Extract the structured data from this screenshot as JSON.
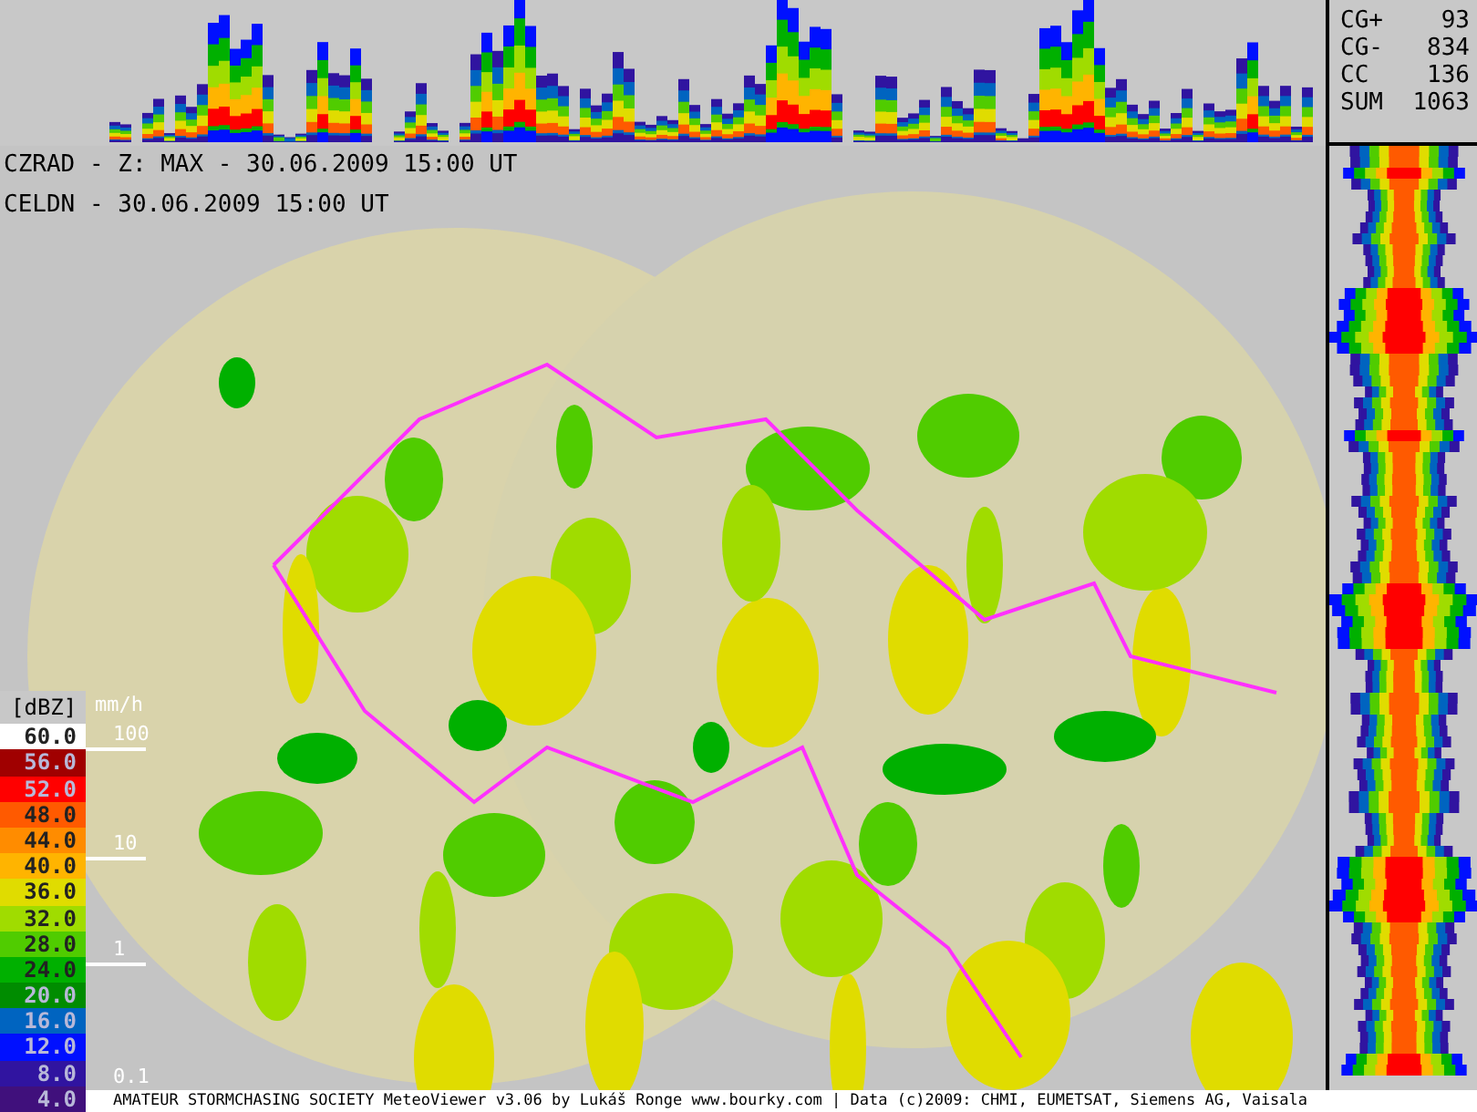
{
  "stats": [
    {
      "label": "CG+",
      "value": "93"
    },
    {
      "label": "CG-",
      "value": "834"
    },
    {
      "label": "CC",
      "value": "136"
    },
    {
      "label": "SUM",
      "value": "1063"
    }
  ],
  "header_lines": [
    "CZRAD - Z: MAX - 30.06.2009 15:00 UT",
    "CELDN - 30.06.2009 15:00 UT"
  ],
  "legend": {
    "unit": "[dBZ]",
    "items": [
      {
        "label": "60.0",
        "color": "#ffffff"
      },
      {
        "label": "56.0",
        "color": "#a00000"
      },
      {
        "label": "52.0",
        "color": "#ff0000"
      },
      {
        "label": "48.0",
        "color": "#ff5a00"
      },
      {
        "label": "44.0",
        "color": "#ff8c00"
      },
      {
        "label": "40.0",
        "color": "#ffb400"
      },
      {
        "label": "36.0",
        "color": "#e0dc00"
      },
      {
        "label": "32.0",
        "color": "#a0dc00"
      },
      {
        "label": "28.0",
        "color": "#50cc00"
      },
      {
        "label": "24.0",
        "color": "#00b000"
      },
      {
        "label": "20.0",
        "color": "#008c00"
      },
      {
        "label": "16.0",
        "color": "#0064c0"
      },
      {
        "label": "12.0",
        "color": "#0010ff"
      },
      {
        "label": "8.0",
        "color": "#3014a0"
      },
      {
        "label": "4.0",
        "color": "#40107c"
      }
    ]
  },
  "rain_scale": {
    "unit": "mm/h",
    "marks": [
      "100",
      "10",
      "1",
      "0.1"
    ]
  },
  "footer": "AMATEUR STORMCHASING SOCIETY MeteoViewer v3.06 by Lukáš Ronge www.bourky.com | Data (c)2009: CHMI, EUMETSAT, Siemens AG, Vaisala"
}
